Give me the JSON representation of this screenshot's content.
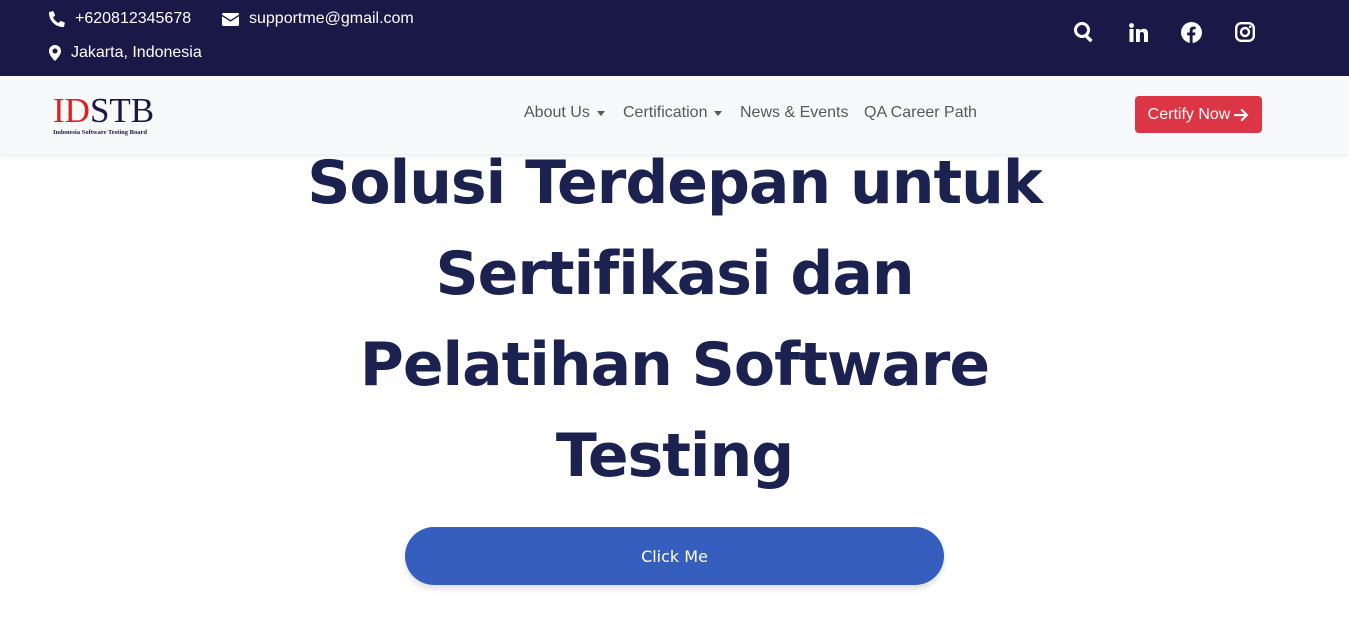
{
  "topbar": {
    "phone": "+620812345678",
    "email": "supportme@gmail.com",
    "location": "Jakarta, Indonesia",
    "icons": [
      "phone-icon",
      "envelope-icon",
      "map-marker-icon",
      "search-icon",
      "linkedin-icon",
      "facebook-icon",
      "instagram-icon"
    ]
  },
  "logo": {
    "id_part": "ID",
    "stb_part": "STB",
    "subtitle": "Indonesia Software Testing Board"
  },
  "nav": {
    "items": [
      {
        "label": "About Us",
        "dropdown": true
      },
      {
        "label": "Certification",
        "dropdown": true
      },
      {
        "label": "News & Events",
        "dropdown": false
      },
      {
        "label": "QA Career Path",
        "dropdown": false
      }
    ],
    "cta_label": "Certify Now"
  },
  "hero": {
    "title_lines": [
      "Solusi Terdepan untuk",
      "Sertifikasi dan",
      "Pelatihan Software",
      "Testing"
    ],
    "button_label": "Click Me"
  },
  "colors": {
    "topbar_bg": "#191847",
    "navbar_bg": "#f8f9fa",
    "cta_red": "#dc3545",
    "hero_text": "#1b2250",
    "hero_button": "#355ebf"
  }
}
